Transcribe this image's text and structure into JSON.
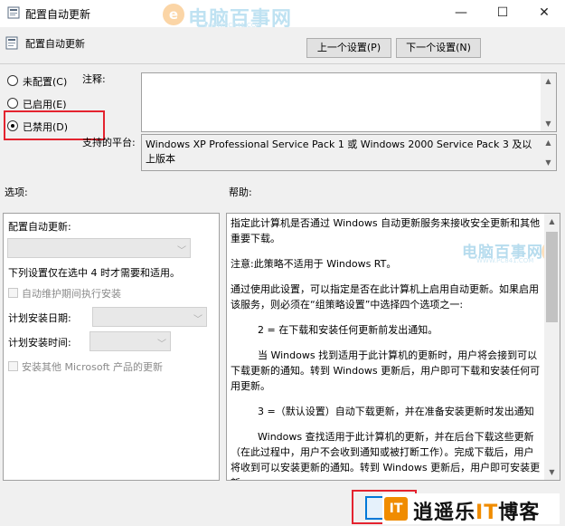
{
  "window": {
    "title": "配置自动更新",
    "minimize": "—",
    "maximize": "☐",
    "close": "✕"
  },
  "watermark_top": {
    "name": "电脑百事网",
    "url": "WWW.PC841.COM"
  },
  "header": {
    "policy_name": "配置自动更新",
    "prev_button": "上一个设置(P)",
    "next_button": "下一个设置(N)"
  },
  "state": {
    "options": [
      {
        "label": "未配置(C)",
        "checked": false
      },
      {
        "label": "已启用(E)",
        "checked": false
      },
      {
        "label": "已禁用(D)",
        "checked": true
      }
    ]
  },
  "comment": {
    "label": "注释:",
    "value": ""
  },
  "platform": {
    "label": "支持的平台:",
    "value": "Windows XP Professional Service Pack 1 或 Windows 2000 Service Pack 3 及以上版本"
  },
  "options_section": {
    "title": "选项:",
    "configure_label": "配置自动更新:",
    "configure_value": "",
    "note": "下列设置仅在选中 4 时才需要和适用。",
    "maintenance_checkbox": "自动维护期间执行安装",
    "schedule_day_label": "计划安装日期:",
    "schedule_time_label": "计划安装时间:",
    "other_products_checkbox": "安装其他 Microsoft 产品的更新"
  },
  "help_section": {
    "title": "帮助:",
    "paragraphs": [
      "指定此计算机是否通过 Windows 自动更新服务来接收安全更新和其他重要下载。",
      "注意:此策略不适用于 Windows RT。",
      "通过使用此设置，可以指定是否在此计算机上启用自动更新。如果启用该服务，则必须在“组策略设置”中选择四个选项之一:",
      "2 = 在下载和安装任何更新前发出通知。",
      "当 Windows 找到适用于此计算机的更新时，用户将会接到可以下载更新的通知。转到 Windows 更新后，用户即可下载和安装任何可用更新。",
      "3 =（默认设置）自动下载更新，并在准备安装更新时发出通知",
      "Windows 查找适用于此计算机的更新，并在后台下载这些更新（在此过程中，用户不会收到通知或被打断工作）。完成下载后，用户将收到可以安装更新的通知。转到 Windows 更新后，用户即可安装更新。"
    ]
  },
  "watermark_help": {
    "name": "电脑百事网",
    "url": "WWW.PC841.COM"
  },
  "footer": {
    "brand_logo": "IT",
    "brand_prefix": "逍遥乐",
    "brand_it": "IT",
    "brand_suffix": "博客"
  },
  "colors": {
    "highlight": "#e4232f",
    "accent": "#0078d7",
    "brand": "#f08c00"
  }
}
